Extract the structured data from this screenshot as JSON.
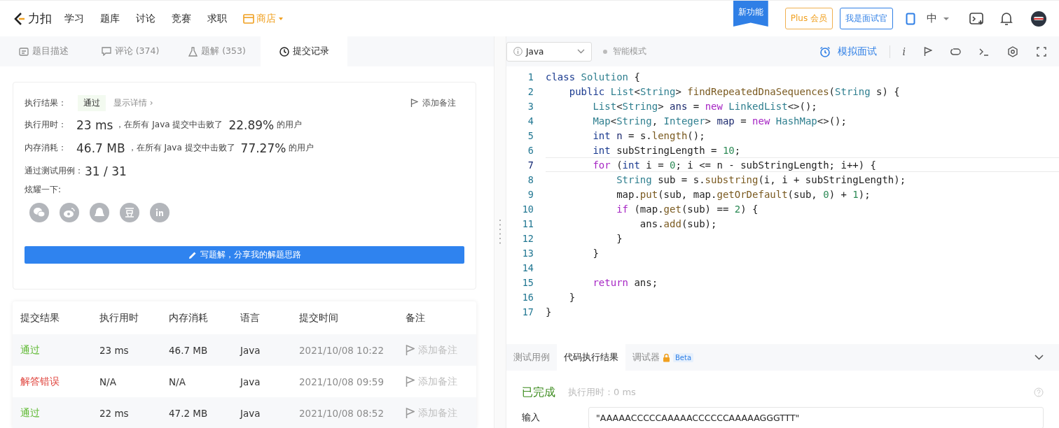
{
  "nav": {
    "logo": "力扣",
    "items": [
      "学习",
      "题库",
      "讨论",
      "竞赛",
      "求职"
    ],
    "shop": "商店",
    "new_feature": "新功能",
    "plus": "Plus 会员",
    "interviewer": "我是面试官",
    "language": "中"
  },
  "tabs": [
    {
      "label": "题目描述",
      "kind": "description",
      "selected": false
    },
    {
      "label": "评论 (374)",
      "kind": "comments",
      "selected": false
    },
    {
      "label": "题解 (353)",
      "kind": "solutions",
      "selected": false
    },
    {
      "label": "提交记录",
      "kind": "submissions",
      "selected": true
    }
  ],
  "result": {
    "status_label": "执行结果：",
    "status": "通过",
    "details": "显示详情 ›",
    "add_note": "添加备注",
    "runtime_label": "执行用时：",
    "runtime": "23 ms",
    "runtime_text": "，在所有 Java 提交中击败了",
    "runtime_pct": "22.89%",
    "runtime_suffix": "的用户",
    "memory_label": "内存消耗：",
    "memory": "46.7 MB",
    "memory_text": "，在所有 Java 提交中击败了",
    "memory_pct": "77.27%",
    "memory_suffix": "的用户",
    "tests_label": "通过测试用例：",
    "tests": "31 / 31",
    "share_label": "炫耀一下:",
    "write_button": "写题解，分享我的解题思路"
  },
  "table": {
    "columns": [
      "提交结果",
      "执行用时",
      "内存消耗",
      "语言",
      "提交时间",
      "备注"
    ],
    "rows": [
      {
        "result": "通过",
        "kind": "accepted",
        "time": "23 ms",
        "memory": "46.7 MB",
        "language": "Java",
        "submitted": "2021/10/08 10:22",
        "note": "添加备注"
      },
      {
        "result": "解答错误",
        "kind": "wrong",
        "time": "N/A",
        "memory": "N/A",
        "language": "Java",
        "submitted": "2021/10/08 09:59",
        "note": "添加备注"
      },
      {
        "result": "通过",
        "kind": "accepted",
        "time": "22 ms",
        "memory": "47.2 MB",
        "language": "Java",
        "submitted": "2021/10/08 08:52",
        "note": "添加备注"
      }
    ]
  },
  "editor": {
    "language": "Java",
    "smart_mode": "智能模式",
    "mock_interview": "模拟面试",
    "info": "i",
    "lines": [
      {
        "number": "1",
        "current": false,
        "tokens": [
          {
            "text": "class ",
            "kind": "keyword"
          },
          {
            "text": "Solution",
            "kind": "type"
          },
          {
            "text": " {",
            "kind": "plain"
          }
        ]
      },
      {
        "number": "2",
        "current": false,
        "tokens": [
          {
            "text": "    public ",
            "kind": "keyword"
          },
          {
            "text": "List",
            "kind": "type"
          },
          {
            "text": "<",
            "kind": "plain"
          },
          {
            "text": "String",
            "kind": "type"
          },
          {
            "text": "> ",
            "kind": "plain"
          },
          {
            "text": "findRepeatedDnaSequences",
            "kind": "method"
          },
          {
            "text": "(",
            "kind": "plain"
          },
          {
            "text": "String",
            "kind": "type"
          },
          {
            "text": " s) {",
            "kind": "plain"
          }
        ]
      },
      {
        "number": "3",
        "current": false,
        "tokens": [
          {
            "text": "        List",
            "kind": "type"
          },
          {
            "text": "<",
            "kind": "plain"
          },
          {
            "text": "String",
            "kind": "type"
          },
          {
            "text": "> ",
            "kind": "plain"
          },
          {
            "text": "ans",
            "kind": "variable"
          },
          {
            "text": " = ",
            "kind": "plain"
          },
          {
            "text": "new ",
            "kind": "control"
          },
          {
            "text": "LinkedList",
            "kind": "type"
          },
          {
            "text": "<>();",
            "kind": "plain"
          }
        ]
      },
      {
        "number": "4",
        "current": false,
        "tokens": [
          {
            "text": "        Map",
            "kind": "type"
          },
          {
            "text": "<",
            "kind": "plain"
          },
          {
            "text": "String",
            "kind": "type"
          },
          {
            "text": ", ",
            "kind": "plain"
          },
          {
            "text": "Integer",
            "kind": "type"
          },
          {
            "text": "> ",
            "kind": "plain"
          },
          {
            "text": "map",
            "kind": "variable"
          },
          {
            "text": " = ",
            "kind": "plain"
          },
          {
            "text": "new ",
            "kind": "control"
          },
          {
            "text": "HashMap",
            "kind": "type"
          },
          {
            "text": "<>();",
            "kind": "plain"
          }
        ]
      },
      {
        "number": "5",
        "current": false,
        "tokens": [
          {
            "text": "        int ",
            "kind": "keyword"
          },
          {
            "text": "n",
            "kind": "variable"
          },
          {
            "text": " = s.",
            "kind": "plain"
          },
          {
            "text": "length",
            "kind": "method"
          },
          {
            "text": "();",
            "kind": "plain"
          }
        ]
      },
      {
        "number": "6",
        "current": false,
        "tokens": [
          {
            "text": "        int",
            "kind": "keyword"
          },
          {
            "text": " subStringLength = ",
            "kind": "plain"
          },
          {
            "text": "10",
            "kind": "number"
          },
          {
            "text": ";",
            "kind": "plain"
          }
        ]
      },
      {
        "number": "7",
        "current": true,
        "tokens": [
          {
            "text": "        for",
            "kind": "control"
          },
          {
            "text": " (",
            "kind": "plain"
          },
          {
            "text": "int",
            "kind": "keyword"
          },
          {
            "text": " i = ",
            "kind": "plain"
          },
          {
            "text": "0",
            "kind": "number"
          },
          {
            "text": "; i <= n - subStringLength; i++) {",
            "kind": "plain"
          }
        ]
      },
      {
        "number": "8",
        "current": false,
        "tokens": [
          {
            "text": "            String",
            "kind": "type"
          },
          {
            "text": " sub = s.",
            "kind": "plain"
          },
          {
            "text": "substring",
            "kind": "method"
          },
          {
            "text": "(i, i + subStringLength);",
            "kind": "plain"
          }
        ]
      },
      {
        "number": "9",
        "current": false,
        "tokens": [
          {
            "text": "            map.",
            "kind": "plain"
          },
          {
            "text": "put",
            "kind": "method"
          },
          {
            "text": "(sub, map.",
            "kind": "plain"
          },
          {
            "text": "getOrDefault",
            "kind": "method"
          },
          {
            "text": "(sub, ",
            "kind": "plain"
          },
          {
            "text": "0",
            "kind": "number"
          },
          {
            "text": ") + ",
            "kind": "plain"
          },
          {
            "text": "1",
            "kind": "number"
          },
          {
            "text": ");",
            "kind": "plain"
          }
        ]
      },
      {
        "number": "10",
        "current": false,
        "tokens": [
          {
            "text": "            if",
            "kind": "control"
          },
          {
            "text": " (map.",
            "kind": "plain"
          },
          {
            "text": "get",
            "kind": "method"
          },
          {
            "text": "(sub) == ",
            "kind": "plain"
          },
          {
            "text": "2",
            "kind": "number"
          },
          {
            "text": ") {",
            "kind": "plain"
          }
        ]
      },
      {
        "number": "11",
        "current": false,
        "tokens": [
          {
            "text": "                ans.",
            "kind": "plain"
          },
          {
            "text": "add",
            "kind": "method"
          },
          {
            "text": "(sub);",
            "kind": "plain"
          }
        ]
      },
      {
        "number": "12",
        "current": false,
        "tokens": [
          {
            "text": "            }",
            "kind": "plain"
          }
        ]
      },
      {
        "number": "13",
        "current": false,
        "tokens": [
          {
            "text": "        }",
            "kind": "plain"
          }
        ]
      },
      {
        "number": "14",
        "current": false
      },
      {
        "number": "15",
        "current": false,
        "tokens": [
          {
            "text": "        return",
            "kind": "control"
          },
          {
            "text": " ans;",
            "kind": "plain"
          }
        ]
      },
      {
        "number": "16",
        "current": false,
        "tokens": [
          {
            "text": "    }",
            "kind": "plain"
          }
        ]
      },
      {
        "number": "17",
        "current": false,
        "tokens": [
          {
            "text": "}",
            "kind": "plain"
          }
        ]
      }
    ]
  },
  "console": {
    "tabs": [
      {
        "label": "测试用例",
        "selected": false
      },
      {
        "label": "代码执行结果",
        "selected": true
      },
      {
        "label": "调试器",
        "selected": false,
        "badge": "Beta"
      }
    ],
    "status": "已完成",
    "runtime": "执行用时：0 ms",
    "input_label": "输入",
    "input": "\"AAAAACCCCCAAAAACCCCCCAAAAAGGGTTT\""
  }
}
